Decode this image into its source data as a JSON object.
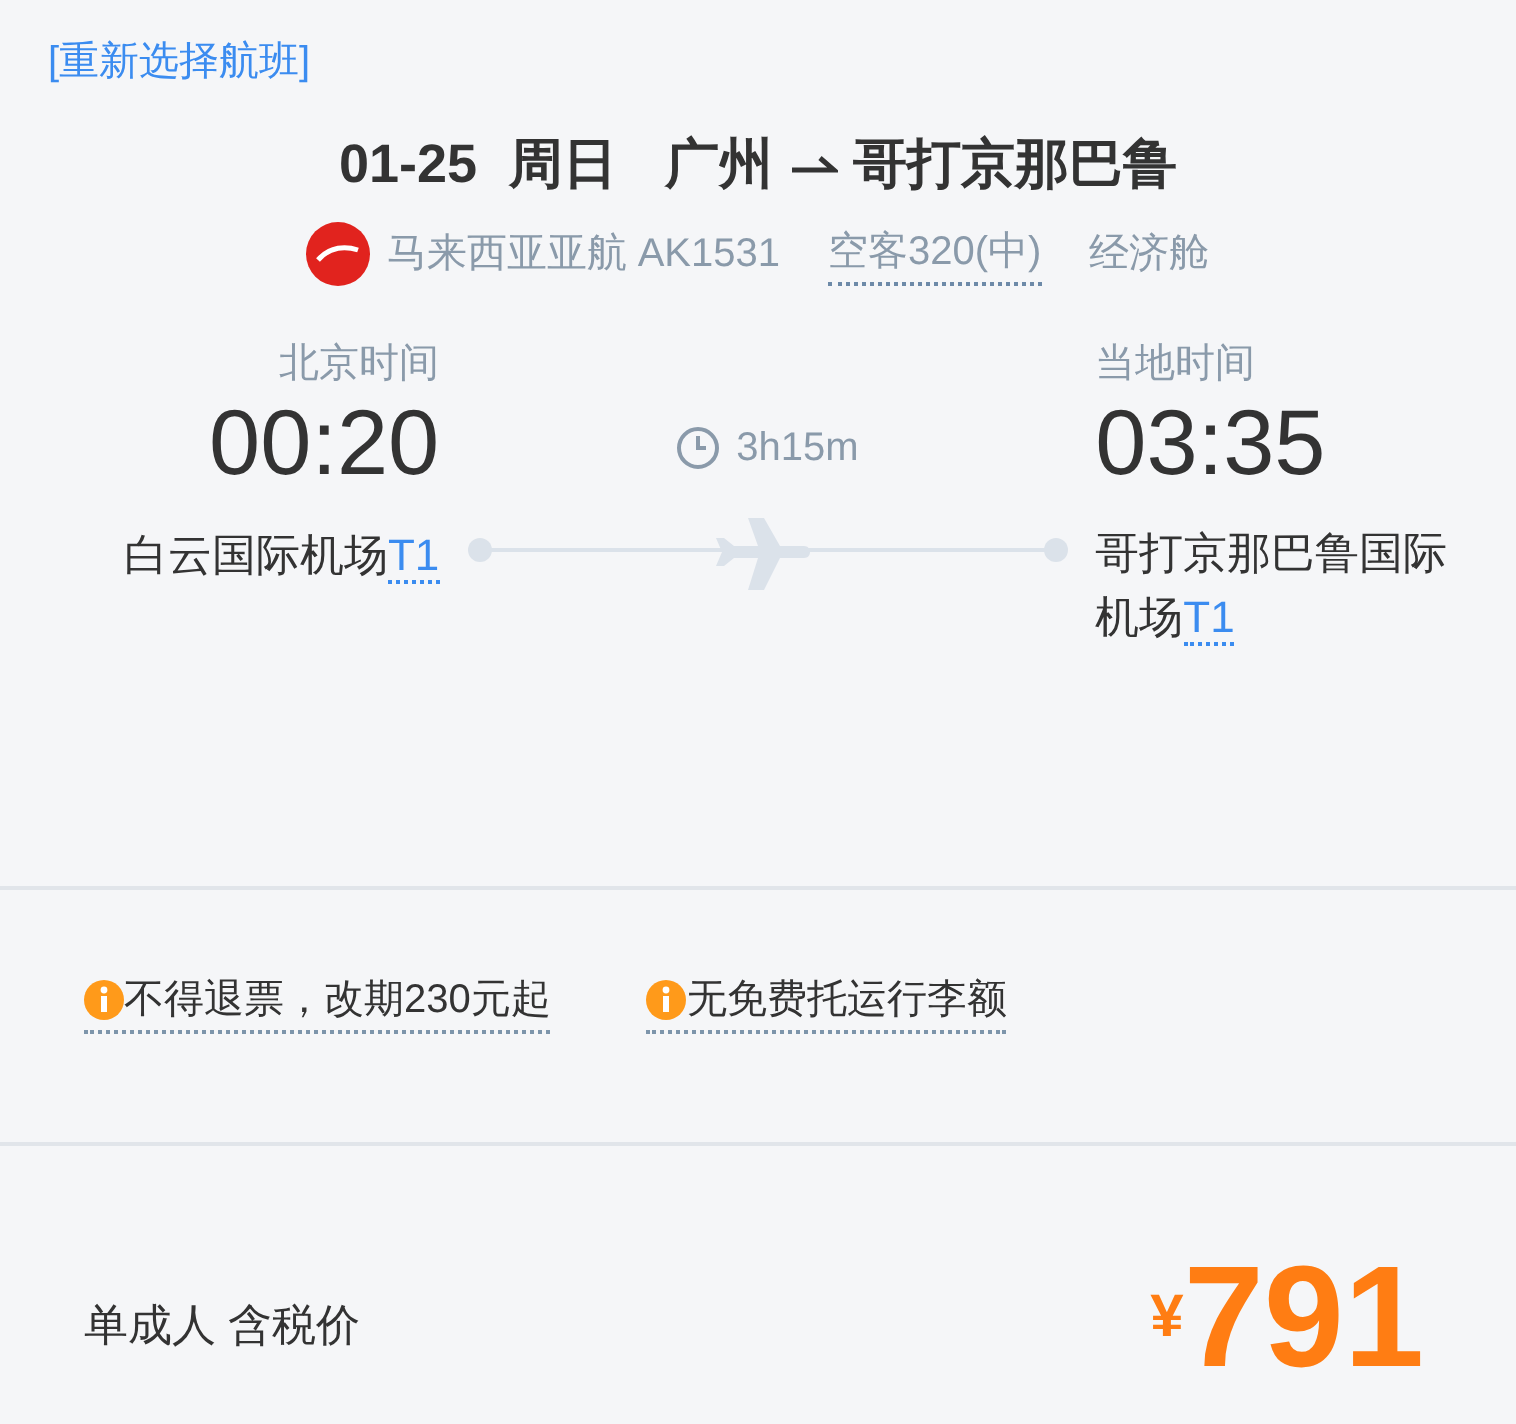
{
  "reselect_link": "[重新选择航班]",
  "header": {
    "date": "01-25",
    "weekday": "周日",
    "from": "广州",
    "to": "哥打京那巴鲁"
  },
  "flight": {
    "airline": "马来西亚亚航 AK1531",
    "aircraft": "空客320(中)",
    "cabin": "经济舱"
  },
  "departure": {
    "zone": "北京时间",
    "time": "00:20",
    "airport": "白云国际机场",
    "terminal": "T1"
  },
  "duration": "3h15m",
  "arrival": {
    "zone": "当地时间",
    "time": "03:35",
    "airport": "哥打京那巴鲁国际机场",
    "terminal": "T1"
  },
  "notices": [
    "不得退票，改期230元起",
    "无免费托运行李额"
  ],
  "price": {
    "label": "单成人 含税价",
    "currency": "¥",
    "amount": "791"
  }
}
